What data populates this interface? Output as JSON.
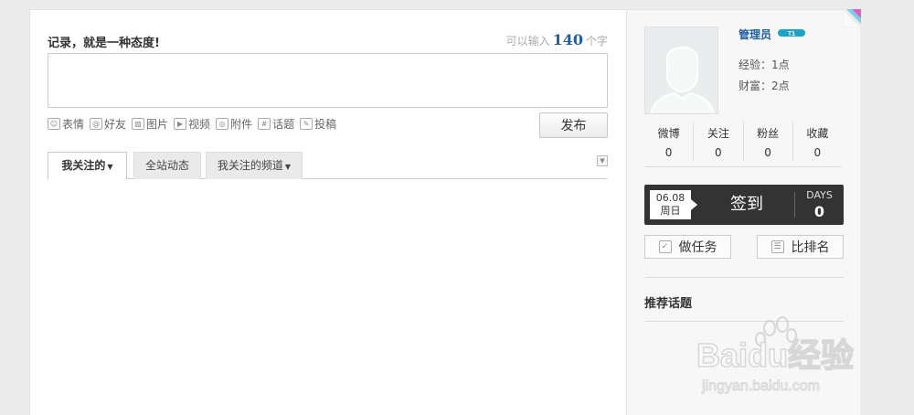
{
  "composer": {
    "title": "记录，就是一种态度!",
    "count_prefix": "可以输入",
    "count_value": "140",
    "count_suffix": "个字",
    "input_value": "",
    "tools": [
      {
        "name": "emoji",
        "label": "表情",
        "icon": "smiley-icon"
      },
      {
        "name": "friends",
        "label": "好友",
        "icon": "at-icon"
      },
      {
        "name": "image",
        "label": "图片",
        "icon": "image-icon"
      },
      {
        "name": "video",
        "label": "视频",
        "icon": "play-icon"
      },
      {
        "name": "attachment",
        "label": "附件",
        "icon": "paperclip-icon"
      },
      {
        "name": "topic",
        "label": "话题",
        "icon": "hash-icon"
      },
      {
        "name": "contribute",
        "label": "投稿",
        "icon": "edit-icon"
      }
    ],
    "publish_label": "发布"
  },
  "feed_tabs": [
    {
      "label": "我关注的",
      "active": true,
      "dropdown": true
    },
    {
      "label": "全站动态",
      "active": false,
      "dropdown": false
    },
    {
      "label": "我关注的频道",
      "active": false,
      "dropdown": true
    }
  ],
  "profile": {
    "username": "管理员",
    "level_badge": "T1",
    "experience": "经验：1点",
    "wealth": "财富：2点",
    "stats": [
      {
        "label": "微博",
        "value": "0"
      },
      {
        "label": "关注",
        "value": "0"
      },
      {
        "label": "粉丝",
        "value": "0"
      },
      {
        "label": "收藏",
        "value": "0"
      }
    ]
  },
  "checkin": {
    "date": "06.08",
    "weekday": "周日",
    "button_label": "签到",
    "days_label": "DAYS",
    "days_value": "0"
  },
  "actions": {
    "task_label": "做任务",
    "rank_label": "比排名"
  },
  "topics": {
    "title": "推荐话题"
  },
  "watermark": {
    "brand": "Baidu经验",
    "url": "jingyan.baidu.com"
  },
  "colors": {
    "link_blue": "#1f5fa7",
    "count_blue": "#225fa0",
    "checkin_dark": "#333333",
    "badge_teal": "#1aa3c4"
  }
}
